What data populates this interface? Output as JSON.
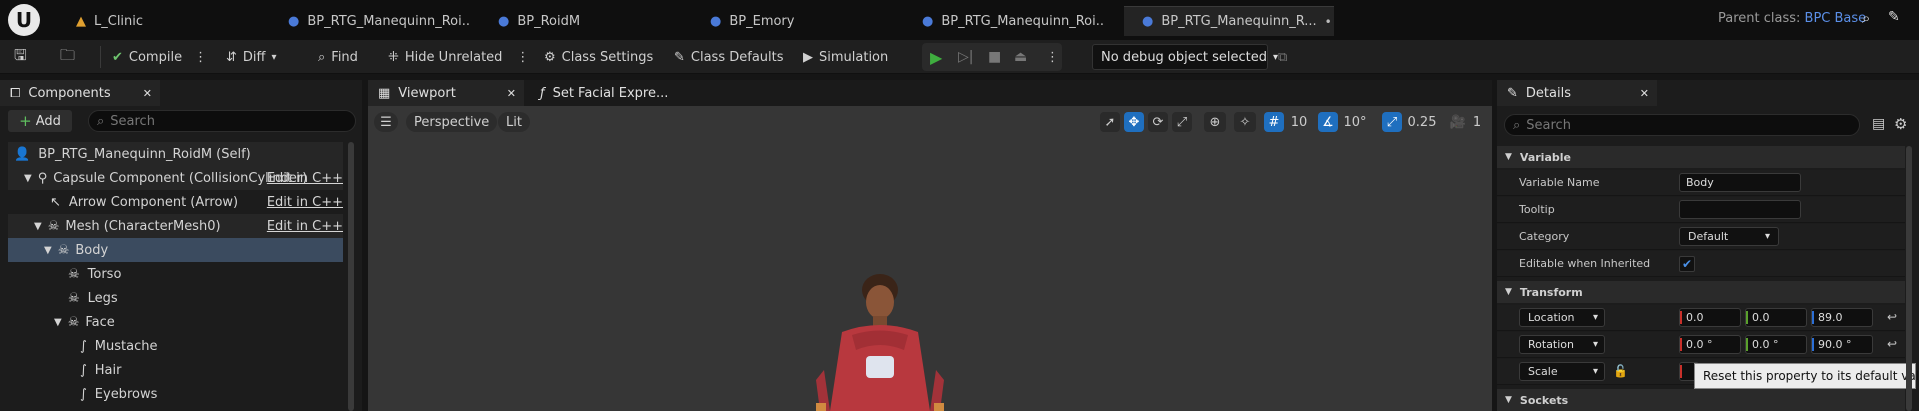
{
  "tabs": [
    {
      "label": "L_Clinic",
      "icon": "level-icon"
    },
    {
      "label": "BP_RTG_Manequinn_Roi...",
      "icon": "blueprint-icon"
    },
    {
      "label": "BP_RoidM",
      "icon": "blueprint-icon"
    },
    {
      "label": "BP_Emory",
      "icon": "blueprint-icon"
    },
    {
      "label": "BP_RTG_Manequinn_Roi...",
      "icon": "blueprint-icon"
    },
    {
      "label": "BP_RTG_Manequinn_R...",
      "icon": "blueprint-icon",
      "active": true
    }
  ],
  "parent_class": {
    "label": "Parent class:",
    "value": "BPC Base"
  },
  "toolbar": {
    "compile": "Compile",
    "diff": "Diff",
    "find": "Find",
    "hide_unrelated": "Hide Unrelated",
    "class_settings": "Class Settings",
    "class_defaults": "Class Defaults",
    "simulation": "Simulation",
    "debug_object": "No debug object selected"
  },
  "components": {
    "title": "Components",
    "add": "Add",
    "search_placeholder": "Search",
    "items": [
      {
        "label": "BP_RTG_Manequinn_RoidM (Self)"
      },
      {
        "label": "Capsule Component (CollisionCylinder)",
        "edit": "Edit in C++"
      },
      {
        "label": "Arrow Component (Arrow)",
        "edit": "Edit in C++"
      },
      {
        "label": "Mesh (CharacterMesh0)",
        "edit": "Edit in C++"
      },
      {
        "label": "Body"
      },
      {
        "label": "Torso"
      },
      {
        "label": "Legs"
      },
      {
        "label": "Face"
      },
      {
        "label": "Mustache"
      },
      {
        "label": "Hair"
      },
      {
        "label": "Eyebrows"
      }
    ]
  },
  "viewport": {
    "tab": "Viewport",
    "function_tab": "Set Facial Expre...",
    "perspective": "Perspective",
    "lit": "Lit",
    "grid_snap": "10",
    "rotation_snap": "10°",
    "scale_snap": "0.25",
    "camera_speed": "1"
  },
  "details": {
    "title": "Details",
    "search_placeholder": "Search",
    "sections": {
      "variable": "Variable",
      "transform": "Transform",
      "sockets": "Sockets"
    },
    "variable_name_label": "Variable Name",
    "variable_name": "Body",
    "tooltip_label": "Tooltip",
    "tooltip": "",
    "category_label": "Category",
    "category": "Default",
    "editable_label": "Editable when Inherited",
    "editable": true,
    "location_label": "Location",
    "location": [
      "0.0",
      "0.0",
      "89.0"
    ],
    "rotation_label": "Rotation",
    "rotation": [
      "0.0 °",
      "0.0 °",
      "90.0 °"
    ],
    "scale_label": "Scale",
    "reset_tooltip": "Reset this property to its default value."
  },
  "colors": {
    "accent": "#1f6fbf",
    "play": "#3fae3f",
    "axis_x": "#c8302a",
    "axis_y": "#5aa02c",
    "axis_z": "#2c6fd6"
  }
}
